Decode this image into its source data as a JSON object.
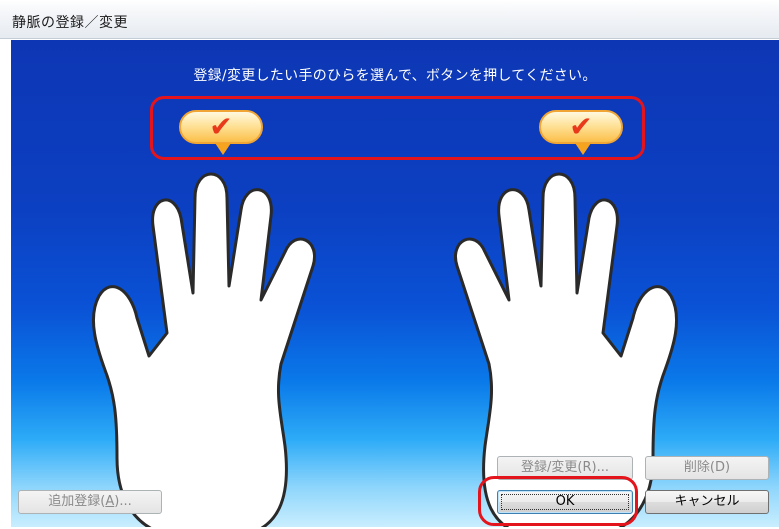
{
  "window": {
    "title": "静脈の登録／変更"
  },
  "instruction": "登録/変更したい手のひらを選んで、ボタンを押してください。",
  "hands": [
    {
      "side": "left",
      "selected": true,
      "badge_icon": "checkmark-icon"
    },
    {
      "side": "right",
      "selected": true,
      "badge_icon": "checkmark-icon"
    }
  ],
  "check_glyph": "✔",
  "buttons": {
    "add_registration": {
      "label": "追加登録(",
      "mnemonic": "A",
      "suffix": ")...",
      "enabled": false
    },
    "register_change": {
      "label": "登録/変更(R)...",
      "enabled": false
    },
    "delete": {
      "label": "削除(D)",
      "enabled": false
    },
    "ok": {
      "label": "OK",
      "enabled": true
    },
    "cancel": {
      "label": "キャンセル",
      "enabled": true
    }
  },
  "colors": {
    "panel_top": "#0d36b4",
    "panel_bottom": "#c9eefe",
    "highlight_ring": "#e3141c",
    "check_mark": "#e8391b",
    "badge_fill": "#ffe29a"
  }
}
